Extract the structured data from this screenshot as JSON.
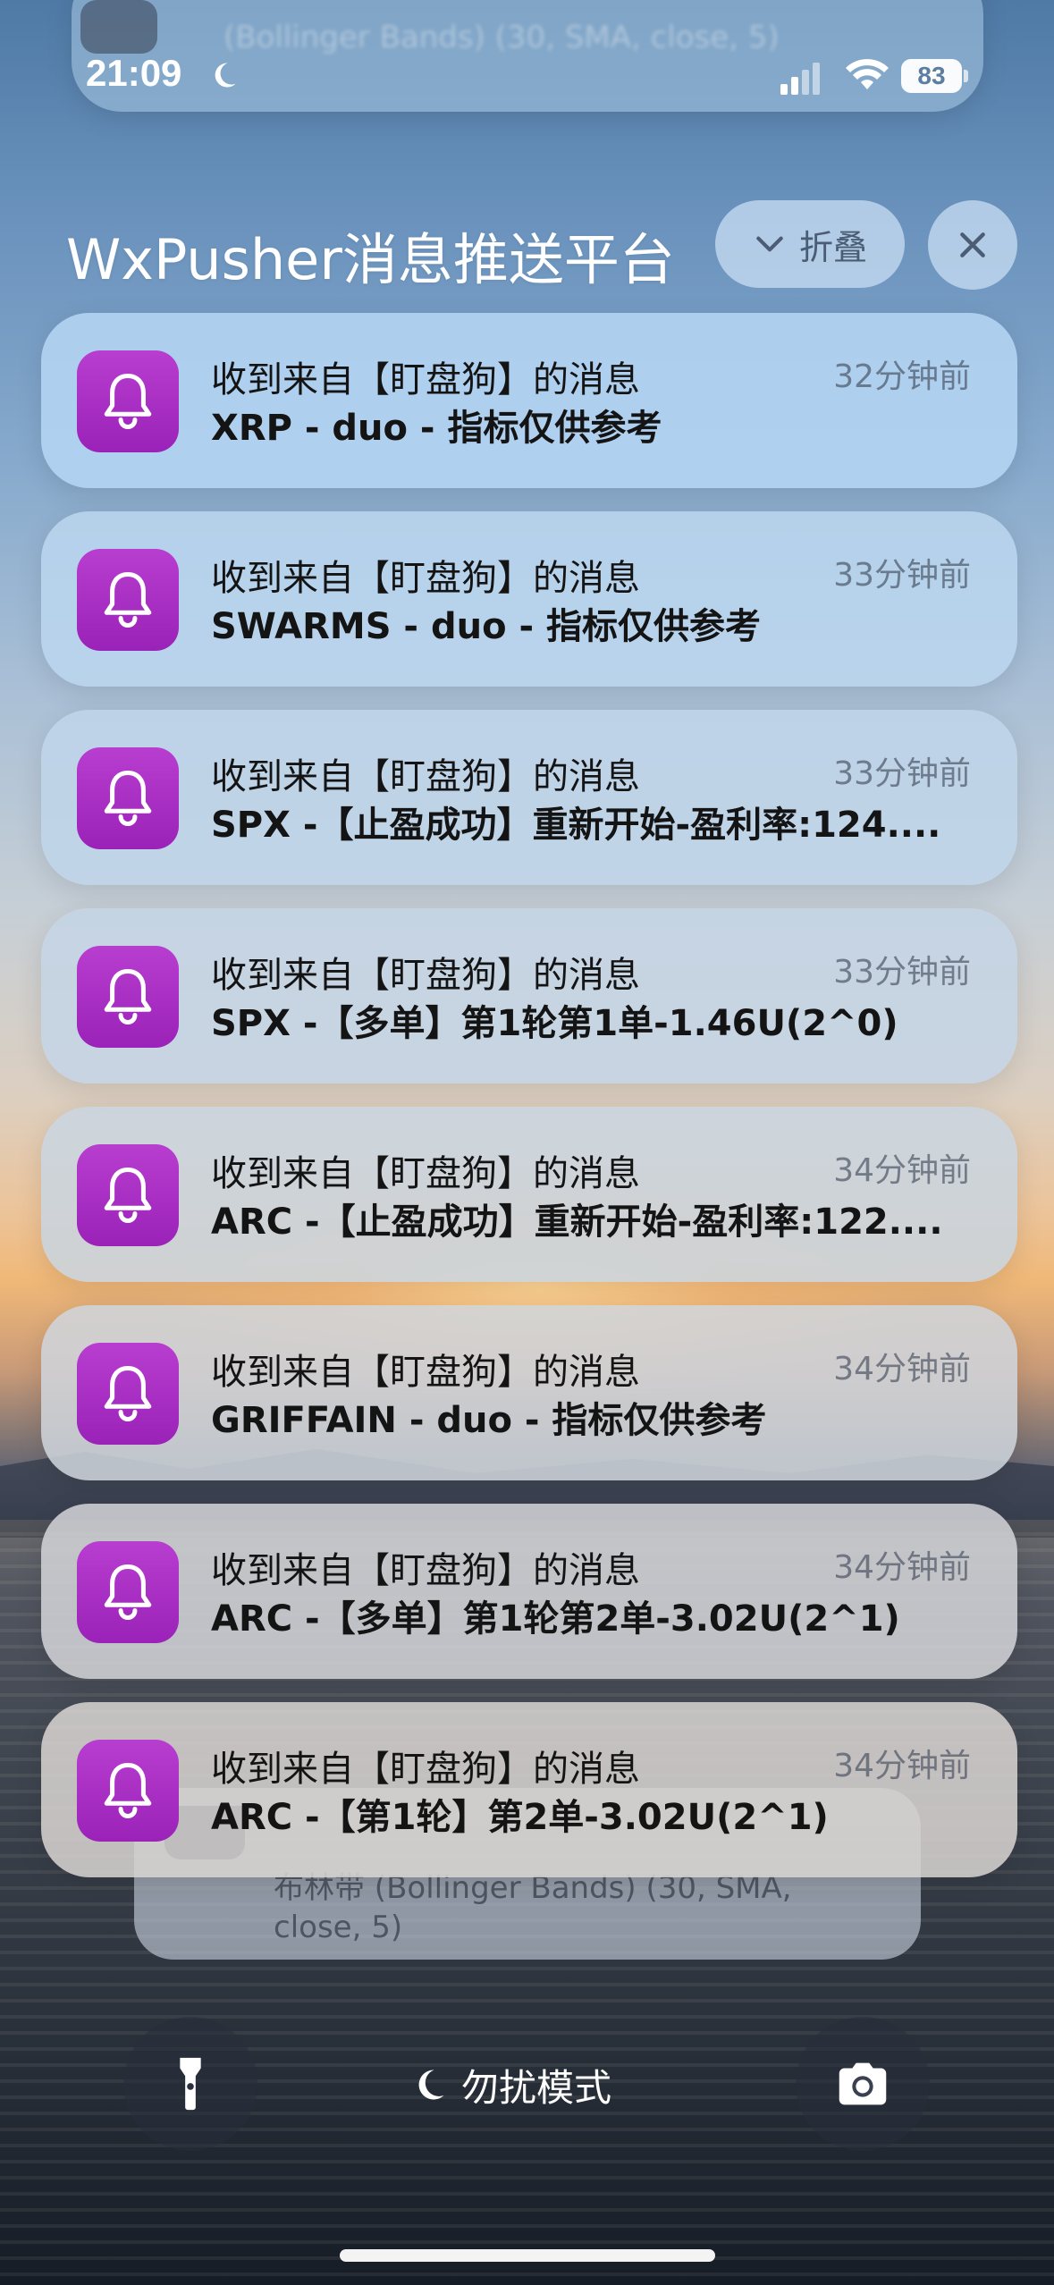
{
  "status_bar": {
    "time": "21:09",
    "battery": "83"
  },
  "group": {
    "title": "WxPusher消息推送平台",
    "collapse_label": "折叠"
  },
  "notifications": [
    {
      "title": "收到来自【盯盘狗】的消息",
      "body": "XRP - duo - 指标仅供参考",
      "time": "32分钟前"
    },
    {
      "title": "收到来自【盯盘狗】的消息",
      "body": "SWARMS - duo - 指标仅供参考",
      "time": "33分钟前"
    },
    {
      "title": "收到来自【盯盘狗】的消息",
      "body": "SPX -【止盈成功】重新开始-盈利率:124....",
      "time": "33分钟前"
    },
    {
      "title": "收到来自【盯盘狗】的消息",
      "body": "SPX -【多单】第1轮第1单-1.46U(2^0)",
      "time": "33分钟前"
    },
    {
      "title": "收到来自【盯盘狗】的消息",
      "body": "ARC -【止盈成功】重新开始-盈利率:122....",
      "time": "34分钟前"
    },
    {
      "title": "收到来自【盯盘狗】的消息",
      "body": "GRIFFAIN - duo - 指标仅供参考",
      "time": "34分钟前"
    },
    {
      "title": "收到来自【盯盘狗】的消息",
      "body": "ARC -【多单】第1轮第2单-3.02U(2^1)",
      "time": "34分钟前"
    },
    {
      "title": "收到来自【盯盘狗】的消息",
      "body": "ARC -【第1轮】第2单-3.02U(2^1)",
      "time": "34分钟前"
    }
  ],
  "top_banner": {
    "text": "(Bollinger Bands) (30, SMA, close, 5)"
  },
  "stacked_notification": {
    "text": "布林带 (Bollinger Bands) (30, SMA, close, 5)"
  },
  "focus": {
    "label": "勿扰模式"
  },
  "colors": {
    "app_icon": "#a52fc4",
    "card_tint_top": "#b7d6f4",
    "card_tint_bottom": "#d8d4d2"
  },
  "icons": {
    "app": "bell-icon",
    "flashlight": "flashlight-icon",
    "camera": "camera-icon",
    "focus": "moon-icon"
  }
}
